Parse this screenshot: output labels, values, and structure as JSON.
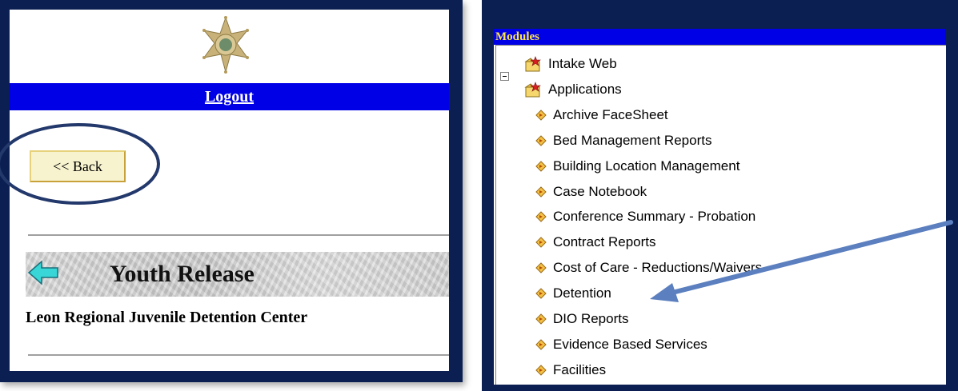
{
  "left": {
    "logout_label": "Logout",
    "back_label": "<< Back",
    "release_title": "Youth Release",
    "center_name": "Leon Regional Juvenile Detention Center"
  },
  "right": {
    "modules_label": "Modules",
    "tree": [
      {
        "label": "Intake Web",
        "icon": "folder-star-icon"
      },
      {
        "label": "Applications",
        "icon": "folder-star-icon",
        "expanded": true
      },
      {
        "label": "Archive FaceSheet",
        "icon": "diamond-arrow-icon"
      },
      {
        "label": "Bed Management Reports",
        "icon": "diamond-arrow-icon"
      },
      {
        "label": "Building Location Management",
        "icon": "diamond-arrow-icon"
      },
      {
        "label": "Case Notebook",
        "icon": "diamond-arrow-icon"
      },
      {
        "label": "Conference Summary - Probation",
        "icon": "diamond-arrow-icon"
      },
      {
        "label": "Contract Reports",
        "icon": "diamond-arrow-icon"
      },
      {
        "label": "Cost of Care - Reductions/Waivers",
        "icon": "diamond-arrow-icon"
      },
      {
        "label": "Detention",
        "icon": "diamond-arrow-icon"
      },
      {
        "label": "DIO Reports",
        "icon": "diamond-arrow-icon"
      },
      {
        "label": "Evidence Based Services",
        "icon": "diamond-arrow-icon"
      },
      {
        "label": "Facilities",
        "icon": "diamond-arrow-icon"
      }
    ]
  },
  "colors": {
    "frame_navy": "#0b1f52",
    "bar_blue": "#0000e6",
    "modules_text": "#ffe84a",
    "annotation_blue": "#5b7fbf"
  }
}
